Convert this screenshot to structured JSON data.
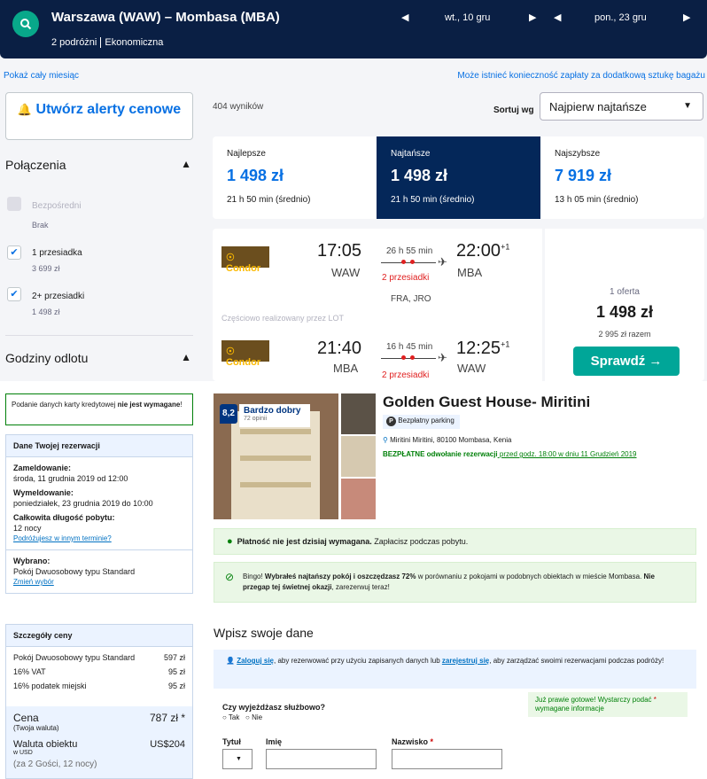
{
  "header": {
    "route": "Warszawa (WAW) – Mombasa (MBA)",
    "passengers": "2 podróżni",
    "cabin": "Ekonomiczna",
    "depart_date": "wt., 10 gru",
    "return_date": "pon., 23 gru"
  },
  "links": {
    "show_month": "Pokaż cały miesiąc",
    "baggage_note": "Może istnieć konieczność zapłaty za dodatkową sztukę bagażu"
  },
  "alert_button": "Utwórz alerty cenowe",
  "filters": {
    "connections_title": "Połączenia",
    "options": [
      {
        "label": "Bezpośredni",
        "price": "Brak",
        "checked": false,
        "disabled": true
      },
      {
        "label": "1 przesiadka",
        "price": "3 699 zł",
        "checked": true,
        "disabled": false
      },
      {
        "label": "2+ przesiadki",
        "price": "1 498 zł",
        "checked": true,
        "disabled": false
      }
    ],
    "departure_title": "Godziny odlotu"
  },
  "results": {
    "count": "404 wyników",
    "sort_label": "Sortuj wg",
    "sort_value": "Najpierw najtańsze"
  },
  "tabs": [
    {
      "label": "Najlepsze",
      "price": "1 498 zł",
      "duration": "21 h 50 min (średnio)"
    },
    {
      "label": "Najtańsze",
      "price": "1 498 zł",
      "duration": "21 h 50 min (średnio)"
    },
    {
      "label": "Najszybsze",
      "price": "7 919 zł",
      "duration": "13 h 05 min (średnio)"
    }
  ],
  "flight": {
    "outbound": {
      "airline": "Condor",
      "dep_time": "17:05",
      "dep_airport": "WAW",
      "duration": "26 h 55 min",
      "stops": "2 przesiadki",
      "via": "FRA, JRO",
      "arr_time": "22:00",
      "arr_plus": "+1",
      "arr_airport": "MBA"
    },
    "operated": "Częściowo realizowany przez LOT",
    "inbound": {
      "airline": "Condor",
      "dep_time": "21:40",
      "dep_airport": "MBA",
      "duration": "16 h 45 min",
      "stops": "2 przesiadki",
      "arr_time": "12:25",
      "arr_plus": "+1",
      "arr_airport": "WAW"
    },
    "offers": "1 oferta",
    "price": "1 498 zł",
    "total": "2 995 zł razem",
    "select": "Sprawdź →"
  },
  "booking": {
    "card_note_pre": "Podanie danych karty kredytowej ",
    "card_note_bold": "nie jest wymagane",
    "card_note_post": "!",
    "details_title": "Dane Twojej rezerwacji",
    "checkin_label": "Zameldowanie:",
    "checkin_value": "środa, 11 grudnia 2019 od 12:00",
    "checkout_label": "Wymeldowanie:",
    "checkout_value": "poniedziałek, 23 grudnia 2019 do 10:00",
    "length_label": "Całkowita długość pobytu:",
    "length_value": "12 nocy",
    "other_date_link": "Podróżujesz w innym terminie?",
    "chosen_label": "Wybrano:",
    "chosen_value": "Pokój Dwuosobowy typu Standard",
    "change_link": "Zmień wybór",
    "price_title": "Szczegóły ceny",
    "price_rows": [
      {
        "label": "Pokój Dwuosobowy typu Standard",
        "value": "597 zł"
      },
      {
        "label": "16% VAT",
        "value": "95 zł"
      },
      {
        "label": "16% podatek miejski",
        "value": "95 zł"
      }
    ],
    "total_label": "Cena",
    "total_sub": "(Twoja waluta)",
    "total_value": "787 zł *",
    "local_label": "Waluta obiektu",
    "local_sub": "w USD",
    "local_value": "US$204",
    "guests": "(za 2 Gości, 12 nocy)"
  },
  "hotel": {
    "rating": "8,2",
    "rating_word": "Bardzo dobry",
    "reviews": "72 opinii",
    "name": "Golden Guest House- Miritini",
    "parking": "Bezpłatny parking",
    "address": "Miritini Miritini, 80100 Mombasa, Kenia",
    "cancel_bold": "BEZPŁATNE odwołanie rezerwacji",
    "cancel_rest": " przed godz. 18:00 w dniu 11 Grudzień 2019",
    "pay_bold": "Płatność nie jest dzisiaj wymagana.",
    "pay_rest": " Zapłacisz podczas pobytu.",
    "bingo_1": "Bingo! ",
    "bingo_2": "Wybrałeś najtańszy pokój i oszczędzasz 72%",
    "bingo_3": " w porównaniu z pokojami w podobnych obiektach w mieście Mombasa. ",
    "bingo_4": "Nie przegap tej świetnej okazji",
    "bingo_5": ", zarezerwuj teraz!"
  },
  "form": {
    "title": "Wpisz swoje dane",
    "login_link": "Zaloguj się",
    "login_mid": ", aby rezerwować przy użyciu zapisanych danych lub ",
    "register_link": "zarejestruj się",
    "login_end": ", aby zarządzać swoimi rezerwacjami podczas podróży!",
    "business_q": "Czy wyjeżdżasz służbowo?",
    "yes": "Tak",
    "no": "Nie",
    "almost_pre": "Już prawie gotowe! Wystarczy podać ",
    "almost_post": " wymagane informacje",
    "title_label": "Tytuł",
    "first_label": "Imię",
    "last_label": "Nazwisko",
    "star": "*"
  },
  "colors": {
    "navy": "#0a1f44",
    "blue": "#0770e3",
    "green": "#00a698",
    "booking_green": "#008009"
  }
}
